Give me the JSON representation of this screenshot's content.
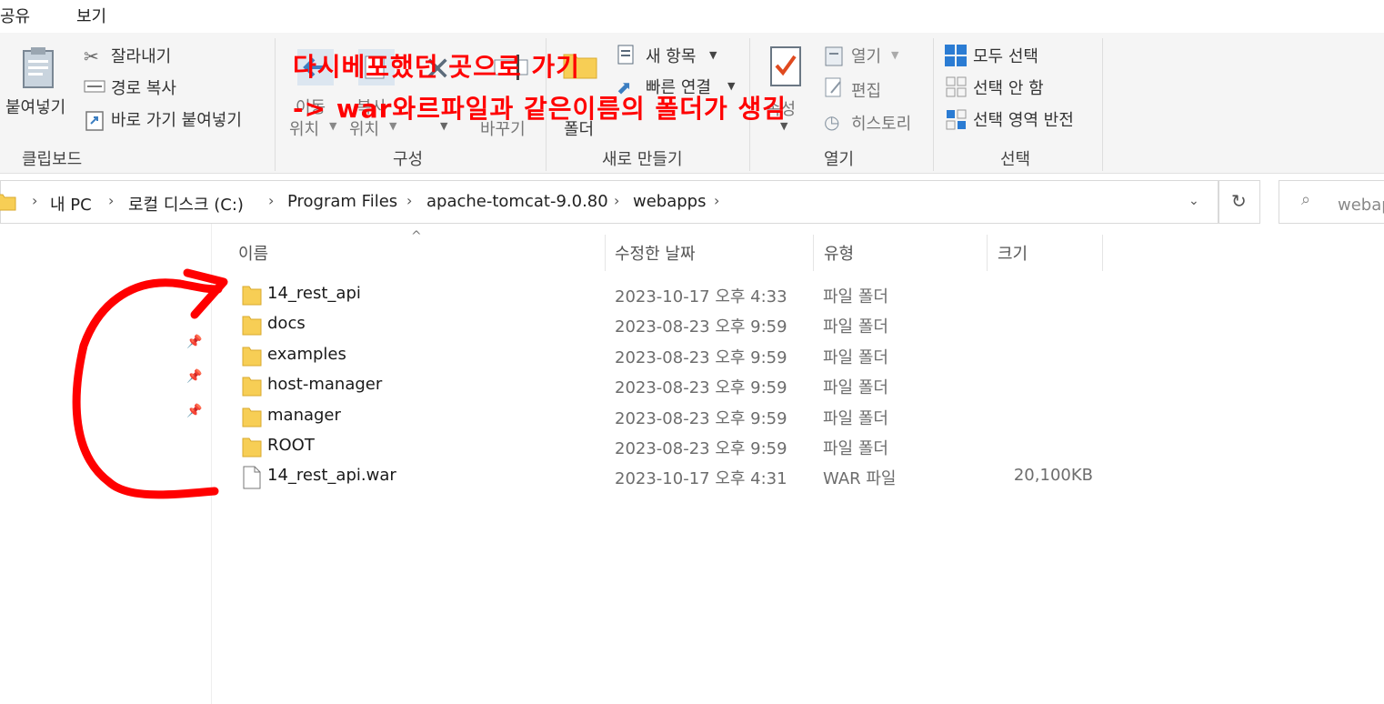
{
  "menu": {
    "share": "공유",
    "view": "보기"
  },
  "ribbon": {
    "clipboard": {
      "paste": "붙여넣기",
      "cut": "잘라내기",
      "copy_path": "경로 복사",
      "paste_shortcut": "바로 가기 붙여넣기",
      "group_label": "클립보드"
    },
    "organize": {
      "move_to_a": "이동",
      "move_to_b": "위치",
      "copy_to_a": "복사",
      "copy_to_b": "위치",
      "rename": "바꾸기",
      "group_label": "구성"
    },
    "new": {
      "new_item": "새 항목",
      "easy_access": "빠른 연결",
      "new_folder": "폴더",
      "group_label": "새로 만들기"
    },
    "open": {
      "properties": "속성",
      "open": "열기",
      "edit": "편집",
      "history": "히스토리",
      "group_label": "열기"
    },
    "select": {
      "select_all": "모두 선택",
      "select_none": "선택 안 함",
      "invert": "선택 영역 반전",
      "group_label": "선택"
    }
  },
  "address": {
    "crumbs": [
      "내 PC",
      "로컬 디스크 (C:)",
      "Program Files",
      "apache-tomcat-9.0.80",
      "webapps"
    ],
    "search_placeholder": "webapps 검색"
  },
  "columns": {
    "name": "이름",
    "date": "수정한 날짜",
    "type": "유형",
    "size": "크기"
  },
  "files": [
    {
      "name": "14_rest_api",
      "date": "2023-10-17 오후 4:33",
      "type": "파일 폴더",
      "size": "",
      "kind": "folder"
    },
    {
      "name": "docs",
      "date": "2023-08-23 오후 9:59",
      "type": "파일 폴더",
      "size": "",
      "kind": "folder"
    },
    {
      "name": "examples",
      "date": "2023-08-23 오후 9:59",
      "type": "파일 폴더",
      "size": "",
      "kind": "folder"
    },
    {
      "name": "host-manager",
      "date": "2023-08-23 오후 9:59",
      "type": "파일 폴더",
      "size": "",
      "kind": "folder"
    },
    {
      "name": "manager",
      "date": "2023-08-23 오후 9:59",
      "type": "파일 폴더",
      "size": "",
      "kind": "folder"
    },
    {
      "name": "ROOT",
      "date": "2023-08-23 오후 9:59",
      "type": "파일 폴더",
      "size": "",
      "kind": "folder"
    },
    {
      "name": "14_rest_api.war",
      "date": "2023-10-17 오후 4:31",
      "type": "WAR 파일",
      "size": "20,100KB",
      "kind": "file"
    }
  ],
  "annotation": {
    "line1": "다시베포했던 곳으로 가기",
    "line2": "-> war와르파일과 같은이름의 폴더가 생김",
    "color": "#ff0000"
  },
  "colors": {
    "folder": "#f7ce55",
    "accent": "#0a78d7"
  }
}
